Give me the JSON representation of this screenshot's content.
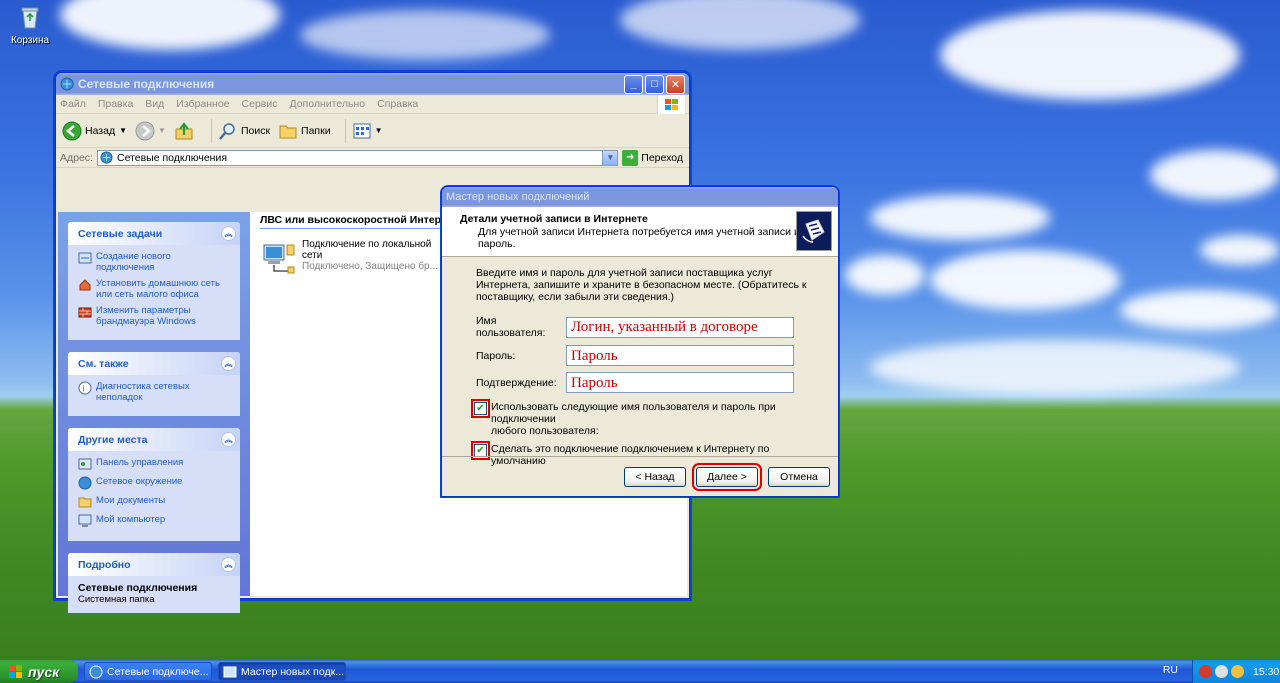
{
  "desktop": {
    "recycle_bin_label": "Корзина"
  },
  "explorer": {
    "title": "Сетевые подключения",
    "menu": [
      "Файл",
      "Правка",
      "Вид",
      "Избранное",
      "Сервис",
      "Дополнительно",
      "Справка"
    ],
    "toolbar": {
      "back_label": "Назад",
      "search_label": "Поиск",
      "folders_label": "Папки"
    },
    "address": {
      "label": "Адрес:",
      "value": "Сетевые подключения",
      "go_label": "Переход"
    },
    "left_panels": {
      "network_tasks": {
        "title": "Сетевые задачи",
        "items": [
          {
            "line1": "Создание нового",
            "line2": "подключения"
          },
          {
            "line1": "Установить домашнюю сеть",
            "line2": "или сеть малого офиса"
          },
          {
            "line1": "Изменить параметры",
            "line2": "брандмауэра Windows"
          }
        ]
      },
      "see_also": {
        "title": "См. также",
        "items": [
          {
            "line1": "Диагностика сетевых",
            "line2": "неполадок"
          }
        ]
      },
      "other_places": {
        "title": "Другие места",
        "items": [
          "Панель управления",
          "Сетевое окружение",
          "Мои документы",
          "Мой компьютер"
        ]
      },
      "details": {
        "title": "Подробно",
        "name": "Сетевые подключения",
        "type": "Системная папка"
      }
    },
    "group_header": "ЛВС или высокоскоростной Интернет",
    "connection": {
      "name_line1": "Подключение по локальной",
      "name_line2": "сети",
      "status": "Подключено, Защищено бр..."
    }
  },
  "wizard": {
    "title": "Мастер новых подключений",
    "header_title": "Детали учетной записи в Интернете",
    "header_subtitle": "Для учетной записи Интернета потребуется имя учетной записи и пароль.",
    "intro": "Введите имя и пароль для учетной записи поставщика услуг Интернета, запишите и храните в безопасном месте. (Обратитесь к поставщику, если забыли эти сведения.)",
    "fields": {
      "username_label": "Имя пользователя:",
      "username_value": "Логин, указанный в договоре",
      "password_label": "Пароль:",
      "password_value": "Пароль",
      "confirm_label": "Подтверждение:",
      "confirm_value": "Пароль"
    },
    "checkboxes": {
      "use_for_all_line1": "Использовать следующие имя пользователя и пароль при подключении",
      "use_for_all_line2": "любого пользователя:",
      "use_for_all_checked": true,
      "default_conn": "Сделать это подключение подключением к Интернету по умолчанию",
      "default_conn_checked": true
    },
    "buttons": {
      "back": "< Назад",
      "next": "Далее >",
      "cancel": "Отмена"
    }
  },
  "taskbar": {
    "start_label": "пуск",
    "tasks": [
      "Сетевые подключе...",
      "Мастер новых подк..."
    ],
    "language": "RU",
    "clock": "15:30"
  }
}
